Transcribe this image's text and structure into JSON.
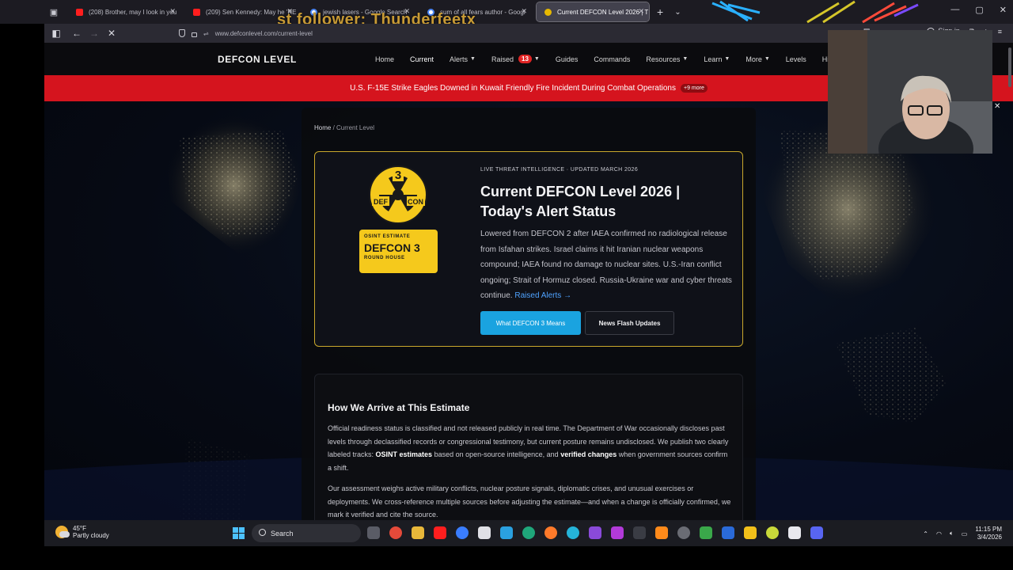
{
  "browser": {
    "tabs": [
      {
        "title": "(208) Brother, may I look in you",
        "icon": "youtube"
      },
      {
        "title": "(209) Sen Kennedy: May he 'RE",
        "icon": "youtube"
      },
      {
        "title": "jewish lasers - Google Search",
        "icon": "google"
      },
      {
        "title": "sum of all fears author - Googl",
        "icon": "google"
      },
      {
        "title": "Current DEFCON Level 2026 | T",
        "icon": "defcon",
        "active": true
      }
    ],
    "overlay_text": "st follower: Thunderfeetx",
    "url": "www.defconlevel.com/current-level",
    "sign_in": "Sign in"
  },
  "site": {
    "logo": "DEFCON LEVEL",
    "menu": [
      {
        "label": "Home",
        "caret": false
      },
      {
        "label": "Current",
        "caret": false,
        "active": true
      },
      {
        "label": "Alerts",
        "caret": true
      },
      {
        "label": "Raised",
        "caret": true,
        "badge": "13"
      },
      {
        "label": "Guides",
        "caret": false
      },
      {
        "label": "Commands",
        "caret": false
      },
      {
        "label": "Resources",
        "caret": true
      },
      {
        "label": "Learn",
        "caret": true
      },
      {
        "label": "More",
        "caret": true
      },
      {
        "label": "Levels",
        "caret": false
      },
      {
        "label": "Histo",
        "caret": false
      }
    ],
    "alert_banner": {
      "text": "U.S. F-15E Strike Eagles Downed in Kuwait Friendly Fire Incident During Combat Operations",
      "more": "+9 more"
    },
    "breadcrumb": {
      "home": "Home",
      "separator": " / ",
      "current": "Current Level"
    },
    "hero": {
      "emblem": {
        "number": "3",
        "left": "DEF",
        "right": "CON"
      },
      "badge": {
        "line1": "OSINT ESTIMATE",
        "line2": "DEFCON 3",
        "line3": "ROUND HOUSE"
      },
      "kicker": "LIVE THREAT INTELLIGENCE · UPDATED MARCH 2026",
      "title": "Current DEFCON Level 2026 | Today's Alert Status",
      "description": "Lowered from DEFCON 2 after IAEA confirmed no radiological release from Isfahan strikes. Israel claims it hit Iranian nuclear weapons compound; IAEA found no damage to nuclear sites. U.S.-Iran conflict ongoing; Strait of Hormuz closed. Russia-Ukraine war and cyber threats continue.",
      "link": "Raised Alerts →",
      "primary_button": "What DEFCON 3 Means",
      "secondary_button": "News Flash Updates"
    },
    "method": {
      "heading": "How We Arrive at This Estimate",
      "p1_a": "Official readiness status is classified and not released publicly in real time. The Department of War occasionally discloses past levels through declassified records or congressional testimony, but current posture remains undisclosed. We publish two clearly labeled tracks: ",
      "p1_b": "OSINT estimates",
      "p1_c": " based on open-source intelligence, and ",
      "p1_d": "verified changes",
      "p1_e": " when government sources confirm a shift.",
      "p2": "Our assessment weighs active military conflicts, nuclear posture signals, diplomatic crises, and unusual exercises or deployments. We cross-reference multiple sources before adjusting the estimate—and when a change is officially confirmed, we mark it verified and cite the source."
    }
  },
  "taskbar": {
    "weather_temp": "45°F",
    "weather_desc": "Partly cloudy",
    "search": "Search",
    "time": "11:15 PM",
    "date": "3/4/2026"
  },
  "colors": {
    "accent_gold": "#c9a82c",
    "alert_red": "#d5141e",
    "button_blue": "#1aa3e0",
    "badge_yellow": "#f5c91c"
  }
}
